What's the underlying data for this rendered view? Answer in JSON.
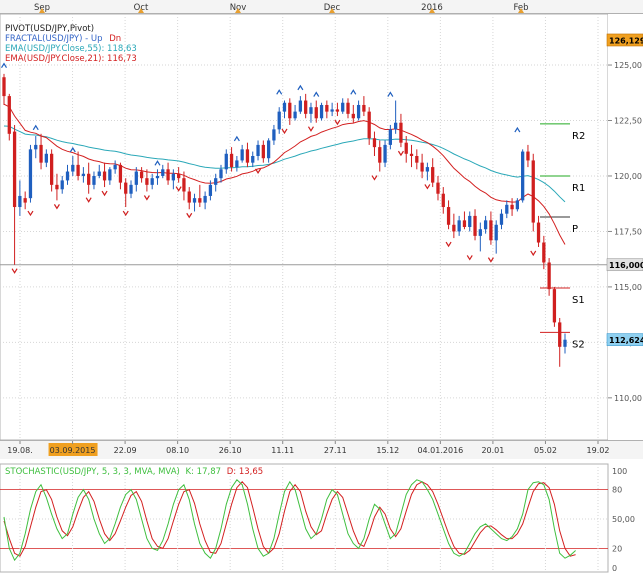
{
  "chart_data": [
    {
      "type": "candlestick",
      "symbol": "USD/JPY",
      "legend": {
        "pivot": "PIVOT(USD/JPY,Pivot)",
        "fractal": "FRACTAL(USD/JPY)",
        "fractal_up": "Up",
        "fractal_dn": "Dn",
        "ema55": "EMA(USD/JPY.Close,55): 118,63",
        "ema21": "EMA(USD/JPY.Close,21): 116,73"
      },
      "month_labels": [
        "Sep",
        "Oct",
        "Nov",
        "Dec",
        "2016",
        "Feb"
      ],
      "x_tick_labels": [
        "19.08.",
        "03.09.2015",
        "22.09",
        "08.10",
        "26.10",
        "11.11",
        "27.11",
        "15.12",
        "04.01.2016",
        "20.01",
        "05.02",
        "19.02"
      ],
      "y_tick_labels": [
        "110,00",
        "112,50",
        "115,00",
        "117,50",
        "120,00",
        "122,50",
        "125,00"
      ],
      "ylim": [
        108.1,
        127.3
      ],
      "price_badges": [
        "126,129",
        "116,000",
        "112,624"
      ],
      "hidden_tick": "112,50",
      "pivot_levels": [
        {
          "label": "R2",
          "value": 122.35
        },
        {
          "label": "R1",
          "value": 120.0
        },
        {
          "label": "P",
          "value": 118.15
        },
        {
          "label": "S1",
          "value": 114.95
        },
        {
          "label": "S2",
          "value": 112.95
        }
      ],
      "ema55_last": "118,63",
      "ema21_last": "116,73",
      "last_close": "112,624",
      "candles": [
        [
          124.45,
          124.6,
          123.2,
          123.6
        ],
        [
          123.6,
          123.7,
          121.6,
          121.9
        ],
        [
          122.0,
          122.3,
          116.0,
          118.6
        ],
        [
          118.6,
          119.8,
          118.2,
          119.1
        ],
        [
          119.0,
          119.3,
          118.5,
          118.8
        ],
        [
          119.0,
          121.4,
          118.8,
          121.2
        ],
        [
          121.2,
          121.8,
          120.8,
          121.4
        ],
        [
          121.4,
          121.9,
          120.3,
          120.6
        ],
        [
          120.6,
          121.2,
          120.4,
          121.0
        ],
        [
          121.0,
          121.2,
          119.3,
          119.6
        ],
        [
          119.6,
          120.1,
          118.9,
          119.4
        ],
        [
          119.4,
          120.0,
          119.2,
          119.8
        ],
        [
          119.8,
          120.5,
          119.6,
          120.2
        ],
        [
          120.2,
          120.9,
          120.0,
          120.5
        ],
        [
          120.5,
          121.1,
          119.8,
          120.0
        ],
        [
          120.0,
          120.4,
          119.7,
          120.1
        ],
        [
          120.1,
          120.6,
          119.2,
          119.6
        ],
        [
          119.6,
          120.2,
          119.4,
          120.0
        ],
        [
          120.0,
          120.5,
          119.9,
          120.2
        ],
        [
          120.2,
          120.6,
          119.5,
          119.8
        ],
        [
          119.8,
          120.4,
          119.6,
          120.3
        ],
        [
          120.3,
          120.7,
          120.1,
          120.5
        ],
        [
          120.5,
          120.6,
          119.4,
          119.7
        ],
        [
          119.7,
          119.9,
          118.6,
          119.2
        ],
        [
          119.2,
          119.8,
          119.0,
          119.6
        ],
        [
          119.6,
          120.4,
          119.3,
          120.2
        ],
        [
          120.2,
          120.4,
          119.7,
          119.9
        ],
        [
          119.9,
          120.3,
          119.3,
          119.6
        ],
        [
          119.6,
          120.1,
          119.4,
          119.9
        ],
        [
          119.9,
          120.3,
          119.6,
          120.0
        ],
        [
          120.0,
          120.5,
          119.9,
          120.3
        ],
        [
          120.3,
          120.6,
          119.6,
          119.8
        ],
        [
          119.8,
          120.3,
          119.4,
          120.1
        ],
        [
          120.1,
          120.4,
          119.7,
          119.9
        ],
        [
          119.9,
          120.2,
          118.9,
          119.3
        ],
        [
          119.3,
          119.5,
          118.5,
          118.8
        ],
        [
          118.8,
          119.2,
          118.4,
          119.0
        ],
        [
          119.0,
          119.6,
          118.6,
          118.8
        ],
        [
          118.8,
          119.3,
          118.5,
          119.1
        ],
        [
          119.1,
          119.8,
          118.9,
          119.6
        ],
        [
          119.6,
          120.1,
          119.3,
          119.9
        ],
        [
          119.9,
          120.5,
          119.7,
          120.3
        ],
        [
          120.3,
          121.2,
          120.1,
          121.0
        ],
        [
          121.0,
          121.3,
          120.2,
          120.4
        ],
        [
          120.4,
          120.9,
          120.2,
          120.7
        ],
        [
          120.7,
          121.4,
          120.6,
          121.2
        ],
        [
          121.2,
          121.5,
          120.4,
          120.6
        ],
        [
          120.6,
          121.1,
          120.4,
          120.9
        ],
        [
          120.9,
          121.6,
          120.7,
          121.4
        ],
        [
          121.4,
          121.6,
          120.6,
          120.8
        ],
        [
          120.8,
          121.7,
          120.6,
          121.6
        ],
        [
          121.6,
          122.3,
          121.4,
          122.1
        ],
        [
          122.1,
          123.1,
          121.9,
          122.9
        ],
        [
          122.9,
          123.4,
          122.6,
          123.3
        ],
        [
          123.3,
          123.5,
          122.3,
          122.6
        ],
        [
          122.6,
          123.2,
          122.5,
          122.9
        ],
        [
          122.9,
          123.6,
          122.8,
          123.4
        ],
        [
          123.4,
          123.7,
          122.6,
          122.8
        ],
        [
          122.8,
          123.3,
          122.4,
          123.1
        ],
        [
          123.1,
          123.4,
          122.4,
          122.6
        ],
        [
          122.6,
          123.3,
          122.5,
          123.2
        ],
        [
          123.2,
          123.4,
          122.6,
          122.9
        ],
        [
          122.9,
          123.3,
          122.7,
          123.0
        ],
        [
          123.0,
          123.3,
          122.7,
          122.9
        ],
        [
          122.9,
          123.5,
          122.8,
          123.3
        ],
        [
          123.3,
          123.5,
          122.6,
          122.8
        ],
        [
          122.8,
          123.2,
          122.4,
          122.6
        ],
        [
          122.6,
          123.4,
          122.5,
          123.2
        ],
        [
          123.2,
          123.6,
          122.7,
          122.9
        ],
        [
          122.9,
          123.1,
          121.4,
          121.7
        ],
        [
          121.7,
          122.0,
          120.9,
          121.3
        ],
        [
          121.3,
          121.6,
          120.2,
          120.6
        ],
        [
          120.6,
          121.6,
          120.4,
          121.4
        ],
        [
          121.4,
          122.3,
          121.2,
          122.1
        ],
        [
          122.1,
          123.4,
          121.9,
          122.4
        ],
        [
          122.4,
          122.8,
          121.3,
          121.5
        ],
        [
          121.5,
          121.8,
          120.6,
          121.0
        ],
        [
          121.0,
          121.4,
          120.4,
          120.9
        ],
        [
          120.9,
          121.2,
          120.3,
          120.6
        ],
        [
          120.6,
          121.0,
          119.9,
          120.2
        ],
        [
          120.2,
          120.6,
          119.8,
          120.4
        ],
        [
          120.4,
          120.8,
          119.5,
          119.7
        ],
        [
          119.7,
          120.0,
          118.9,
          119.2
        ],
        [
          119.2,
          119.5,
          118.3,
          118.6
        ],
        [
          118.6,
          118.9,
          117.6,
          117.8
        ],
        [
          117.8,
          118.3,
          117.2,
          117.5
        ],
        [
          117.5,
          118.2,
          117.3,
          118.0
        ],
        [
          118.0,
          118.4,
          117.6,
          117.7
        ],
        [
          117.7,
          118.4,
          117.5,
          118.2
        ],
        [
          118.2,
          118.5,
          117.1,
          117.3
        ],
        [
          117.3,
          117.9,
          116.6,
          117.6
        ],
        [
          117.6,
          118.2,
          117.4,
          118.0
        ],
        [
          118.0,
          118.4,
          116.9,
          117.1
        ],
        [
          117.1,
          118.0,
          116.5,
          117.8
        ],
        [
          117.8,
          118.5,
          117.6,
          118.3
        ],
        [
          118.3,
          118.9,
          118.1,
          118.7
        ],
        [
          118.7,
          119.0,
          118.2,
          118.5
        ],
        [
          118.5,
          119.0,
          118.4,
          118.9
        ],
        [
          118.9,
          121.2,
          118.8,
          121.1
        ],
        [
          121.1,
          121.4,
          120.4,
          120.7
        ],
        [
          120.7,
          121.0,
          117.5,
          117.9
        ],
        [
          117.9,
          118.2,
          116.8,
          117.0
        ],
        [
          117.0,
          117.3,
          115.8,
          116.1
        ],
        [
          116.1,
          116.3,
          114.6,
          114.9
        ],
        [
          114.9,
          115.0,
          113.2,
          113.4
        ],
        [
          113.4,
          113.6,
          111.4,
          112.3
        ],
        [
          112.3,
          112.9,
          112.0,
          112.62
        ]
      ],
      "fractals_up": [
        [
          0,
          124.7
        ],
        [
          6,
          121.9
        ],
        [
          13,
          120.9
        ],
        [
          29,
          120.3
        ],
        [
          44,
          121.4
        ],
        [
          52,
          123.5
        ],
        [
          56,
          123.7
        ],
        [
          59,
          123.4
        ],
        [
          66,
          123.5
        ],
        [
          73,
          123.4
        ],
        [
          97,
          121.8
        ]
      ],
      "fractals_dn": [
        [
          2,
          116.0
        ],
        [
          5,
          118.6
        ],
        [
          10,
          118.9
        ],
        [
          16,
          119.2
        ],
        [
          19,
          119.5
        ],
        [
          23,
          118.6
        ],
        [
          27,
          119.3
        ],
        [
          33,
          119.7
        ],
        [
          35,
          118.5
        ],
        [
          48,
          120.5
        ],
        [
          53,
          122.3
        ],
        [
          58,
          122.4
        ],
        [
          63,
          122.7
        ],
        [
          70,
          120.2
        ],
        [
          75,
          121.3
        ],
        [
          80,
          119.8
        ],
        [
          84,
          117.2
        ],
        [
          88,
          116.6
        ],
        [
          92,
          116.5
        ],
        [
          100,
          116.8
        ]
      ],
      "oscillator": {
        "label": "STOCHASTIC(USD/JPY, 5, 3, 3, MVA, MVA)",
        "k_label": "K: 17,87",
        "d_label": "D: 13,65",
        "ylim": [
          0,
          100
        ],
        "y_tick_labels": [
          "100",
          "80",
          "50,00",
          "20",
          "0"
        ],
        "levels": [
          80,
          20
        ],
        "k": [
          52,
          20,
          8,
          15,
          35,
          60,
          78,
          85,
          72,
          55,
          40,
          30,
          35,
          55,
          72,
          80,
          70,
          50,
          35,
          25,
          30,
          45,
          62,
          75,
          80,
          70,
          50,
          30,
          20,
          18,
          28,
          45,
          65,
          80,
          85,
          70,
          45,
          25,
          15,
          10,
          20,
          40,
          65,
          82,
          90,
          85,
          65,
          40,
          20,
          12,
          15,
          30,
          55,
          78,
          88,
          80,
          60,
          40,
          30,
          35,
          50,
          70,
          80,
          75,
          55,
          35,
          25,
          20,
          30,
          50,
          65,
          60,
          45,
          30,
          35,
          55,
          75,
          85,
          90,
          88,
          80,
          70,
          55,
          40,
          25,
          15,
          12,
          15,
          25,
          35,
          42,
          45,
          40,
          35,
          30,
          28,
          32,
          40,
          55,
          80,
          87,
          88,
          85,
          70,
          40,
          15,
          10,
          13,
          17.87
        ],
        "d": [
          48,
          30,
          15,
          12,
          22,
          42,
          62,
          78,
          80,
          70,
          52,
          38,
          33,
          42,
          58,
          72,
          78,
          68,
          50,
          35,
          28,
          35,
          48,
          62,
          74,
          78,
          68,
          48,
          30,
          22,
          20,
          30,
          48,
          65,
          78,
          80,
          66,
          45,
          28,
          16,
          15,
          25,
          45,
          65,
          82,
          88,
          82,
          62,
          40,
          22,
          15,
          20,
          35,
          58,
          78,
          85,
          78,
          58,
          42,
          34,
          38,
          55,
          70,
          78,
          72,
          55,
          38,
          25,
          22,
          35,
          52,
          62,
          55,
          40,
          32,
          40,
          58,
          75,
          85,
          88,
          85,
          78,
          65,
          50,
          35,
          22,
          15,
          14,
          18,
          27,
          36,
          42,
          43,
          39,
          34,
          30,
          30,
          35,
          45,
          62,
          78,
          86,
          87,
          82,
          65,
          38,
          20,
          12,
          13.65
        ]
      }
    }
  ]
}
